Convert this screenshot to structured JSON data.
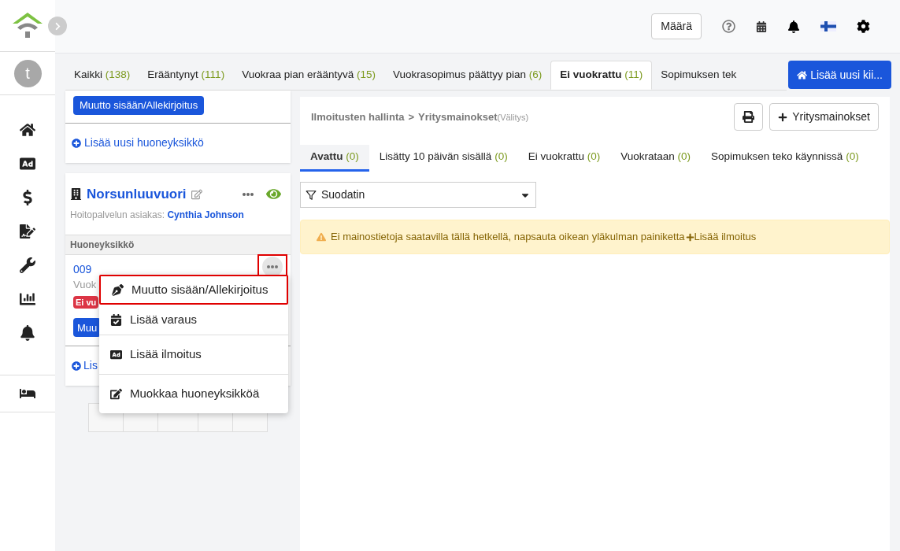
{
  "top_bar": {
    "amount_button": "Määrä"
  },
  "sidebar": {
    "avatar": "t"
  },
  "status_tabs": [
    {
      "label": "Kaikki",
      "count": "(138)",
      "selected": false
    },
    {
      "label": "Erääntynyt",
      "count": "(111)",
      "selected": false
    },
    {
      "label": "Vuokraa pian erääntyvä",
      "count": "(15)",
      "selected": false
    },
    {
      "label": "Vuokrasopimus päättyy pian",
      "count": "(6)",
      "selected": false
    },
    {
      "label": "Ei vuokrattu",
      "count": "(11)",
      "selected": true
    },
    {
      "label": "Sopimuksen tek",
      "selected": false
    }
  ],
  "add_property_button": "Lisää uusi kii...",
  "previous_card": {
    "button": "Muutto sisään/Allekirjoitus",
    "add_unit_link": "Lisää uusi huoneyksikkö"
  },
  "property_card": {
    "name": "Norsunluuvuori",
    "client_label": "Hoitopalvelun asiakas:",
    "client_name": "Cynthia Johnson",
    "visible": true,
    "section_label": "Huoneyksikkö",
    "unit": {
      "number": "009",
      "status_text": "Vuok",
      "badge": "Ei vu",
      "button": "Muu",
      "menu_open": true
    },
    "add_unit_link": "Lis"
  },
  "context_menu": [
    {
      "kind": "pen",
      "label": "Muutto sisään/Allekirjoitus",
      "highlighted": true
    },
    {
      "kind": "calendar",
      "label": "Lisää varaus",
      "highlighted": false
    },
    {
      "kind": "ad",
      "label": "Lisää ilmoitus",
      "highlighted": false
    },
    {
      "kind": "edit",
      "label": "Muokkaa huoneyksikköä",
      "highlighted": false
    }
  ],
  "panel": {
    "breadcrumb_parent": "Ilmoitusten hallinta",
    "breadcrumb_separator": ">",
    "breadcrumb_current": "Yritysmainokset",
    "breadcrumb_note": "(Välitys)",
    "add_button": "Yritysmainokset",
    "tabs": [
      {
        "label": "Avattu",
        "count": "(0)",
        "selected": true
      },
      {
        "label": "Lisätty 10 päivän sisällä",
        "count": "(0)",
        "selected": false
      },
      {
        "label": "Ei vuokrattu",
        "count": "(0)",
        "selected": false
      },
      {
        "label": "Vuokrataan",
        "count": "(0)",
        "selected": false
      },
      {
        "label": "Sopimuksen teko käynnissä",
        "count": "(0)",
        "selected": false
      }
    ],
    "filter": {
      "label": "Suodatin"
    },
    "alert": {
      "text": "Ei mainostietoja saatavilla tällä hetkellä, napsauta oikean yläkulman painiketta",
      "link": "Lisää ilmoitus"
    }
  }
}
